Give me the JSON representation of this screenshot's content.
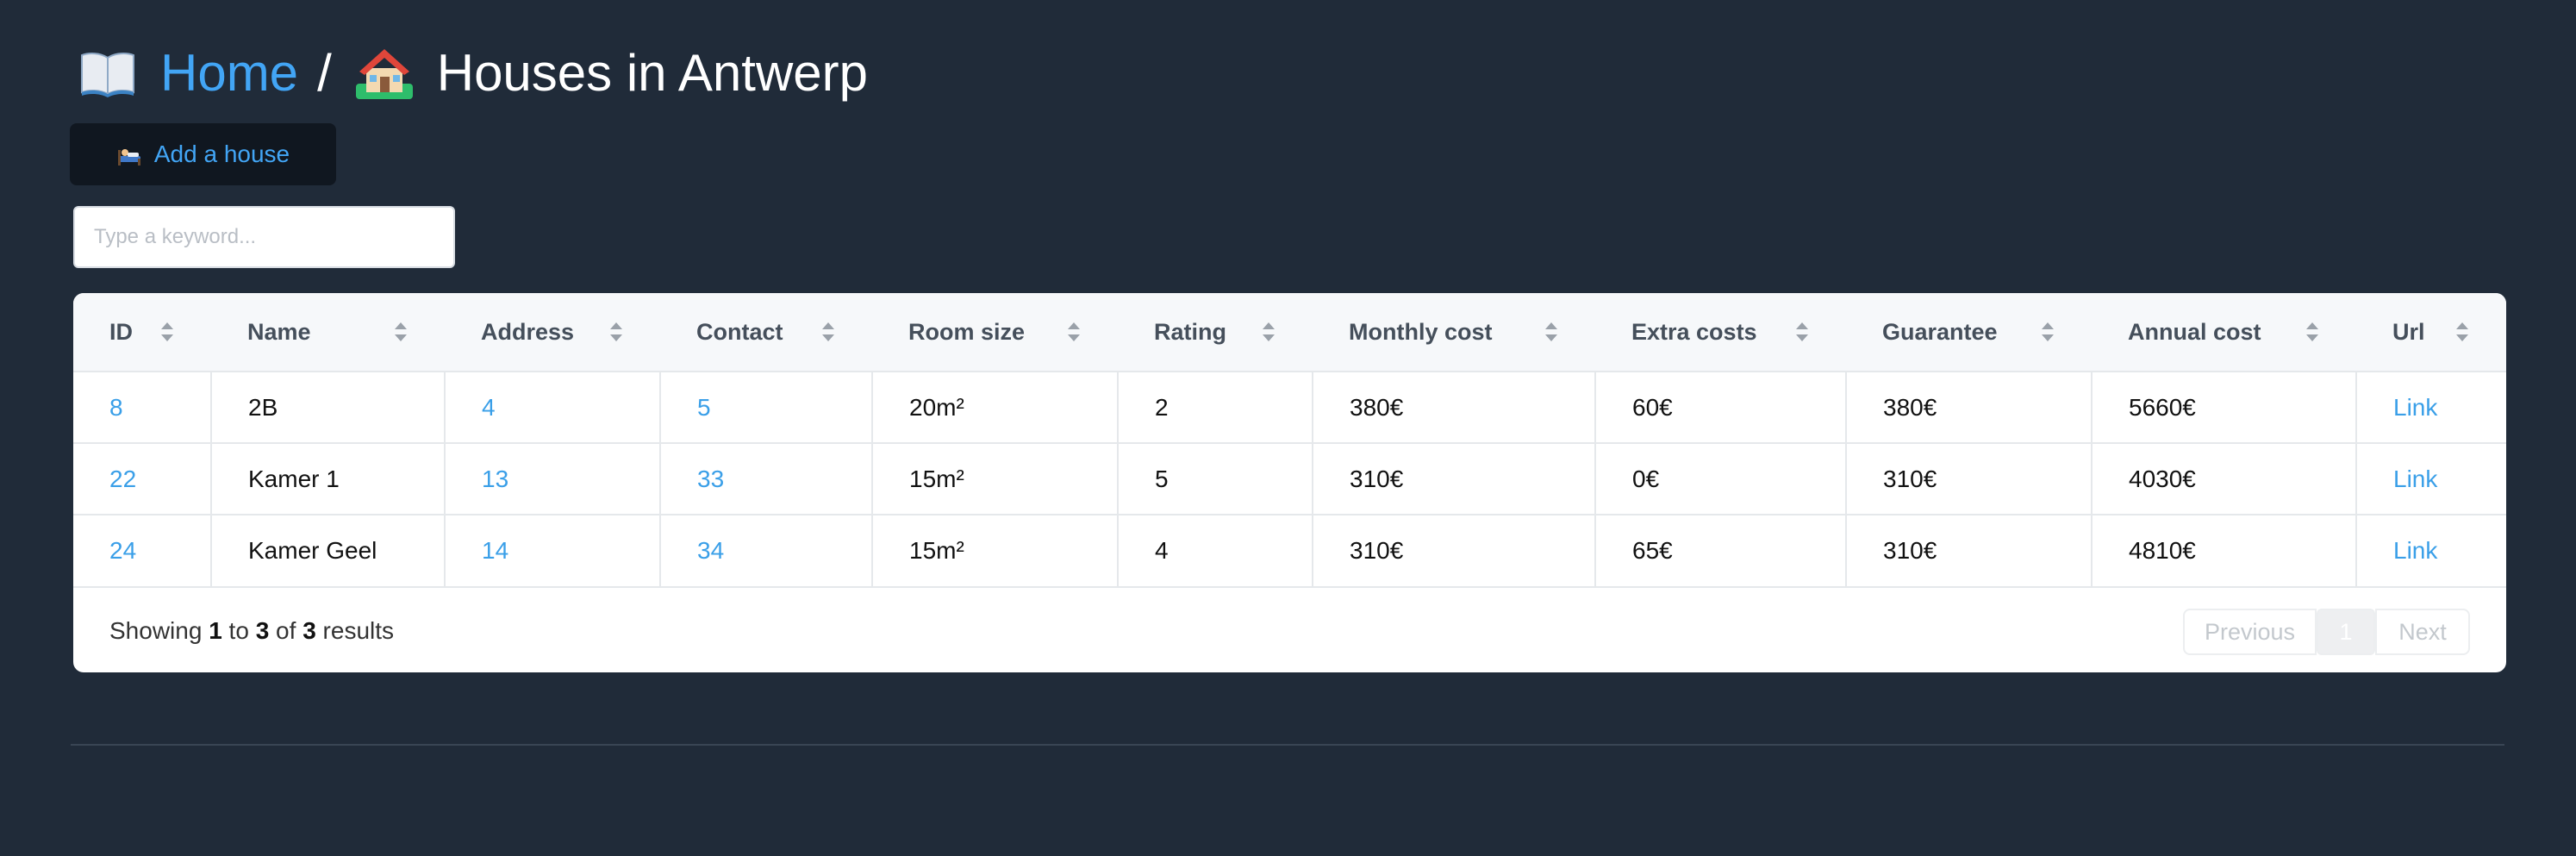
{
  "header": {
    "home_label": "Home",
    "separator": "/",
    "title": "Houses in Antwerp",
    "book_icon": "open-book-icon",
    "house_icon": "house-with-garden-icon"
  },
  "toolbar": {
    "add_label": "Add a house",
    "add_icon": "person-in-bed-icon"
  },
  "search": {
    "placeholder": "Type a keyword..."
  },
  "table": {
    "columns": [
      "ID",
      "Name",
      "Address",
      "Contact",
      "Room size",
      "Rating",
      "Monthly cost",
      "Extra costs",
      "Guarantee",
      "Annual cost",
      "Url"
    ],
    "rows": [
      [
        "8",
        "2B",
        "4",
        "5",
        "20m²",
        "2",
        "380€",
        "60€",
        "380€",
        "5660€",
        "Link"
      ],
      [
        "22",
        "Kamer 1",
        "13",
        "33",
        "15m²",
        "5",
        "310€",
        "0€",
        "310€",
        "4030€",
        "Link"
      ],
      [
        "24",
        "Kamer Geel",
        "14",
        "34",
        "15m²",
        "4",
        "310€",
        "65€",
        "310€",
        "4810€",
        "Link"
      ]
    ]
  },
  "pagination": {
    "showing_prefix": "Showing",
    "from": "1",
    "to_word": "to",
    "to": "3",
    "of_word": "of",
    "total": "3",
    "results_word": "results",
    "previous_label": "Previous",
    "current_page": "1",
    "next_label": "Next"
  },
  "colors": {
    "background": "#202b39",
    "accent": "#42a5f5",
    "link": "#3a9fe8"
  }
}
